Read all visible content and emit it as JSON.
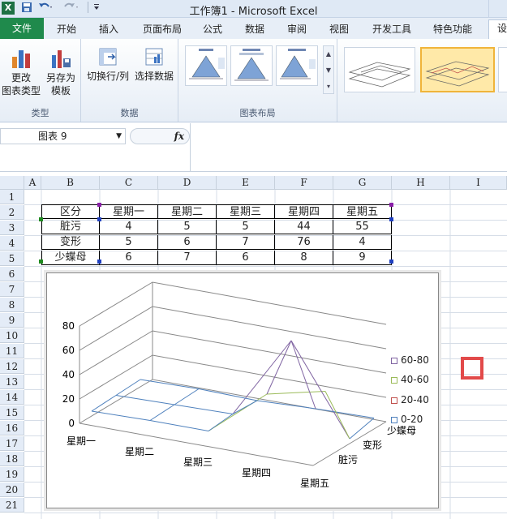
{
  "window": {
    "title": "工作簿1 - Microsoft Excel",
    "app_icon": "X"
  },
  "tabs": [
    {
      "label": "文件"
    },
    {
      "label": "开始"
    },
    {
      "label": "插入"
    },
    {
      "label": "页面布局"
    },
    {
      "label": "公式"
    },
    {
      "label": "数据"
    },
    {
      "label": "审阅"
    },
    {
      "label": "视图"
    },
    {
      "label": "开发工具"
    },
    {
      "label": "特色功能"
    },
    {
      "label": "设"
    }
  ],
  "ribbon": {
    "groups": [
      {
        "label": "类型",
        "buttons": [
          {
            "line1": "更改",
            "line2": "图表类型"
          },
          {
            "line1": "另存为",
            "line2": "模板"
          }
        ]
      },
      {
        "label": "数据",
        "buttons": [
          {
            "line1": "切换行/列"
          },
          {
            "line1": "选择数据"
          }
        ]
      },
      {
        "label": "图表布局"
      }
    ]
  },
  "formula_bar": {
    "name_box": "图表 9",
    "fx": "fx"
  },
  "columns": [
    "A",
    "B",
    "C",
    "D",
    "E",
    "F",
    "G",
    "H",
    "I"
  ],
  "rows": [
    "1",
    "2",
    "3",
    "4",
    "5",
    "6",
    "7",
    "8",
    "9",
    "10",
    "11",
    "12",
    "13",
    "14",
    "15",
    "16",
    "17",
    "18",
    "19",
    "20",
    "21"
  ],
  "table": {
    "header": [
      "区分",
      "星期一",
      "星期二",
      "星期三",
      "星期四",
      "星期五"
    ],
    "rows": [
      [
        "脏污",
        "4",
        "5",
        "5",
        "44",
        "55"
      ],
      [
        "变形",
        "5",
        "6",
        "7",
        "76",
        "4"
      ],
      [
        "少蝶母",
        "6",
        "7",
        "6",
        "8",
        "9"
      ]
    ]
  },
  "chart_data": {
    "type": "surface",
    "x": [
      "星期一",
      "星期二",
      "星期三",
      "星期四",
      "星期五"
    ],
    "depth": [
      "脏污",
      "变形",
      "少蝶母"
    ],
    "yticks": [
      "0",
      "20",
      "40",
      "60",
      "80"
    ],
    "legend": [
      "60-80",
      "40-60",
      "20-40",
      "0-20"
    ],
    "legend_colors": [
      "#8064a2",
      "#9bbb59",
      "#c0504d",
      "#4f81bd"
    ],
    "series": [
      {
        "name": "脏污",
        "values": [
          4,
          5,
          5,
          44,
          55
        ]
      },
      {
        "name": "变形",
        "values": [
          5,
          6,
          7,
          76,
          4
        ]
      },
      {
        "name": "少蝶母",
        "values": [
          6,
          7,
          6,
          8,
          9
        ]
      }
    ]
  }
}
